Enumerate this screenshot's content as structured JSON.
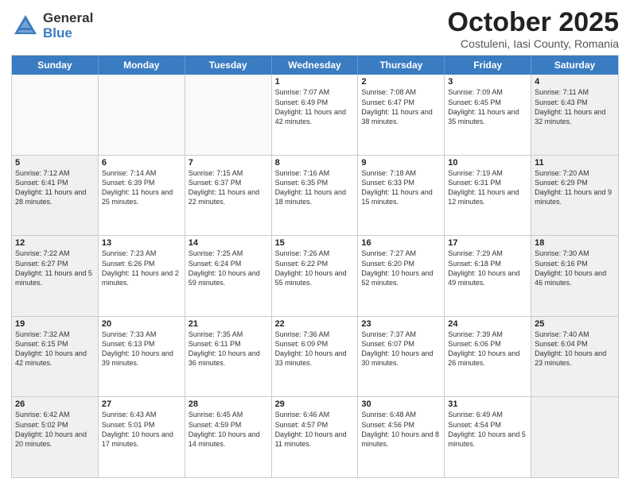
{
  "header": {
    "logo_general": "General",
    "logo_blue": "Blue",
    "month_title": "October 2025",
    "subtitle": "Costuleni, Iasi County, Romania"
  },
  "weekdays": [
    "Sunday",
    "Monday",
    "Tuesday",
    "Wednesday",
    "Thursday",
    "Friday",
    "Saturday"
  ],
  "rows": [
    [
      {
        "day": "",
        "info": "",
        "empty": true
      },
      {
        "day": "",
        "info": "",
        "empty": true
      },
      {
        "day": "",
        "info": "",
        "empty": true
      },
      {
        "day": "1",
        "info": "Sunrise: 7:07 AM\nSunset: 6:49 PM\nDaylight: 11 hours and 42 minutes.",
        "empty": false
      },
      {
        "day": "2",
        "info": "Sunrise: 7:08 AM\nSunset: 6:47 PM\nDaylight: 11 hours and 38 minutes.",
        "empty": false
      },
      {
        "day": "3",
        "info": "Sunrise: 7:09 AM\nSunset: 6:45 PM\nDaylight: 11 hours and 35 minutes.",
        "empty": false
      },
      {
        "day": "4",
        "info": "Sunrise: 7:11 AM\nSunset: 6:43 PM\nDaylight: 11 hours and 32 minutes.",
        "empty": false,
        "shaded": true
      }
    ],
    [
      {
        "day": "5",
        "info": "Sunrise: 7:12 AM\nSunset: 6:41 PM\nDaylight: 11 hours and 28 minutes.",
        "empty": false,
        "shaded": true
      },
      {
        "day": "6",
        "info": "Sunrise: 7:14 AM\nSunset: 6:39 PM\nDaylight: 11 hours and 25 minutes.",
        "empty": false
      },
      {
        "day": "7",
        "info": "Sunrise: 7:15 AM\nSunset: 6:37 PM\nDaylight: 11 hours and 22 minutes.",
        "empty": false
      },
      {
        "day": "8",
        "info": "Sunrise: 7:16 AM\nSunset: 6:35 PM\nDaylight: 11 hours and 18 minutes.",
        "empty": false
      },
      {
        "day": "9",
        "info": "Sunrise: 7:18 AM\nSunset: 6:33 PM\nDaylight: 11 hours and 15 minutes.",
        "empty": false
      },
      {
        "day": "10",
        "info": "Sunrise: 7:19 AM\nSunset: 6:31 PM\nDaylight: 11 hours and 12 minutes.",
        "empty": false
      },
      {
        "day": "11",
        "info": "Sunrise: 7:20 AM\nSunset: 6:29 PM\nDaylight: 11 hours and 9 minutes.",
        "empty": false,
        "shaded": true
      }
    ],
    [
      {
        "day": "12",
        "info": "Sunrise: 7:22 AM\nSunset: 6:27 PM\nDaylight: 11 hours and 5 minutes.",
        "empty": false,
        "shaded": true
      },
      {
        "day": "13",
        "info": "Sunrise: 7:23 AM\nSunset: 6:26 PM\nDaylight: 11 hours and 2 minutes.",
        "empty": false
      },
      {
        "day": "14",
        "info": "Sunrise: 7:25 AM\nSunset: 6:24 PM\nDaylight: 10 hours and 59 minutes.",
        "empty": false
      },
      {
        "day": "15",
        "info": "Sunrise: 7:26 AM\nSunset: 6:22 PM\nDaylight: 10 hours and 55 minutes.",
        "empty": false
      },
      {
        "day": "16",
        "info": "Sunrise: 7:27 AM\nSunset: 6:20 PM\nDaylight: 10 hours and 52 minutes.",
        "empty": false
      },
      {
        "day": "17",
        "info": "Sunrise: 7:29 AM\nSunset: 6:18 PM\nDaylight: 10 hours and 49 minutes.",
        "empty": false
      },
      {
        "day": "18",
        "info": "Sunrise: 7:30 AM\nSunset: 6:16 PM\nDaylight: 10 hours and 46 minutes.",
        "empty": false,
        "shaded": true
      }
    ],
    [
      {
        "day": "19",
        "info": "Sunrise: 7:32 AM\nSunset: 6:15 PM\nDaylight: 10 hours and 42 minutes.",
        "empty": false,
        "shaded": true
      },
      {
        "day": "20",
        "info": "Sunrise: 7:33 AM\nSunset: 6:13 PM\nDaylight: 10 hours and 39 minutes.",
        "empty": false
      },
      {
        "day": "21",
        "info": "Sunrise: 7:35 AM\nSunset: 6:11 PM\nDaylight: 10 hours and 36 minutes.",
        "empty": false
      },
      {
        "day": "22",
        "info": "Sunrise: 7:36 AM\nSunset: 6:09 PM\nDaylight: 10 hours and 33 minutes.",
        "empty": false
      },
      {
        "day": "23",
        "info": "Sunrise: 7:37 AM\nSunset: 6:07 PM\nDaylight: 10 hours and 30 minutes.",
        "empty": false
      },
      {
        "day": "24",
        "info": "Sunrise: 7:39 AM\nSunset: 6:06 PM\nDaylight: 10 hours and 26 minutes.",
        "empty": false
      },
      {
        "day": "25",
        "info": "Sunrise: 7:40 AM\nSunset: 6:04 PM\nDaylight: 10 hours and 23 minutes.",
        "empty": false,
        "shaded": true
      }
    ],
    [
      {
        "day": "26",
        "info": "Sunrise: 6:42 AM\nSunset: 5:02 PM\nDaylight: 10 hours and 20 minutes.",
        "empty": false,
        "shaded": true
      },
      {
        "day": "27",
        "info": "Sunrise: 6:43 AM\nSunset: 5:01 PM\nDaylight: 10 hours and 17 minutes.",
        "empty": false
      },
      {
        "day": "28",
        "info": "Sunrise: 6:45 AM\nSunset: 4:59 PM\nDaylight: 10 hours and 14 minutes.",
        "empty": false
      },
      {
        "day": "29",
        "info": "Sunrise: 6:46 AM\nSunset: 4:57 PM\nDaylight: 10 hours and 11 minutes.",
        "empty": false
      },
      {
        "day": "30",
        "info": "Sunrise: 6:48 AM\nSunset: 4:56 PM\nDaylight: 10 hours and 8 minutes.",
        "empty": false
      },
      {
        "day": "31",
        "info": "Sunrise: 6:49 AM\nSunset: 4:54 PM\nDaylight: 10 hours and 5 minutes.",
        "empty": false
      },
      {
        "day": "",
        "info": "",
        "empty": true,
        "shaded": true
      }
    ]
  ]
}
